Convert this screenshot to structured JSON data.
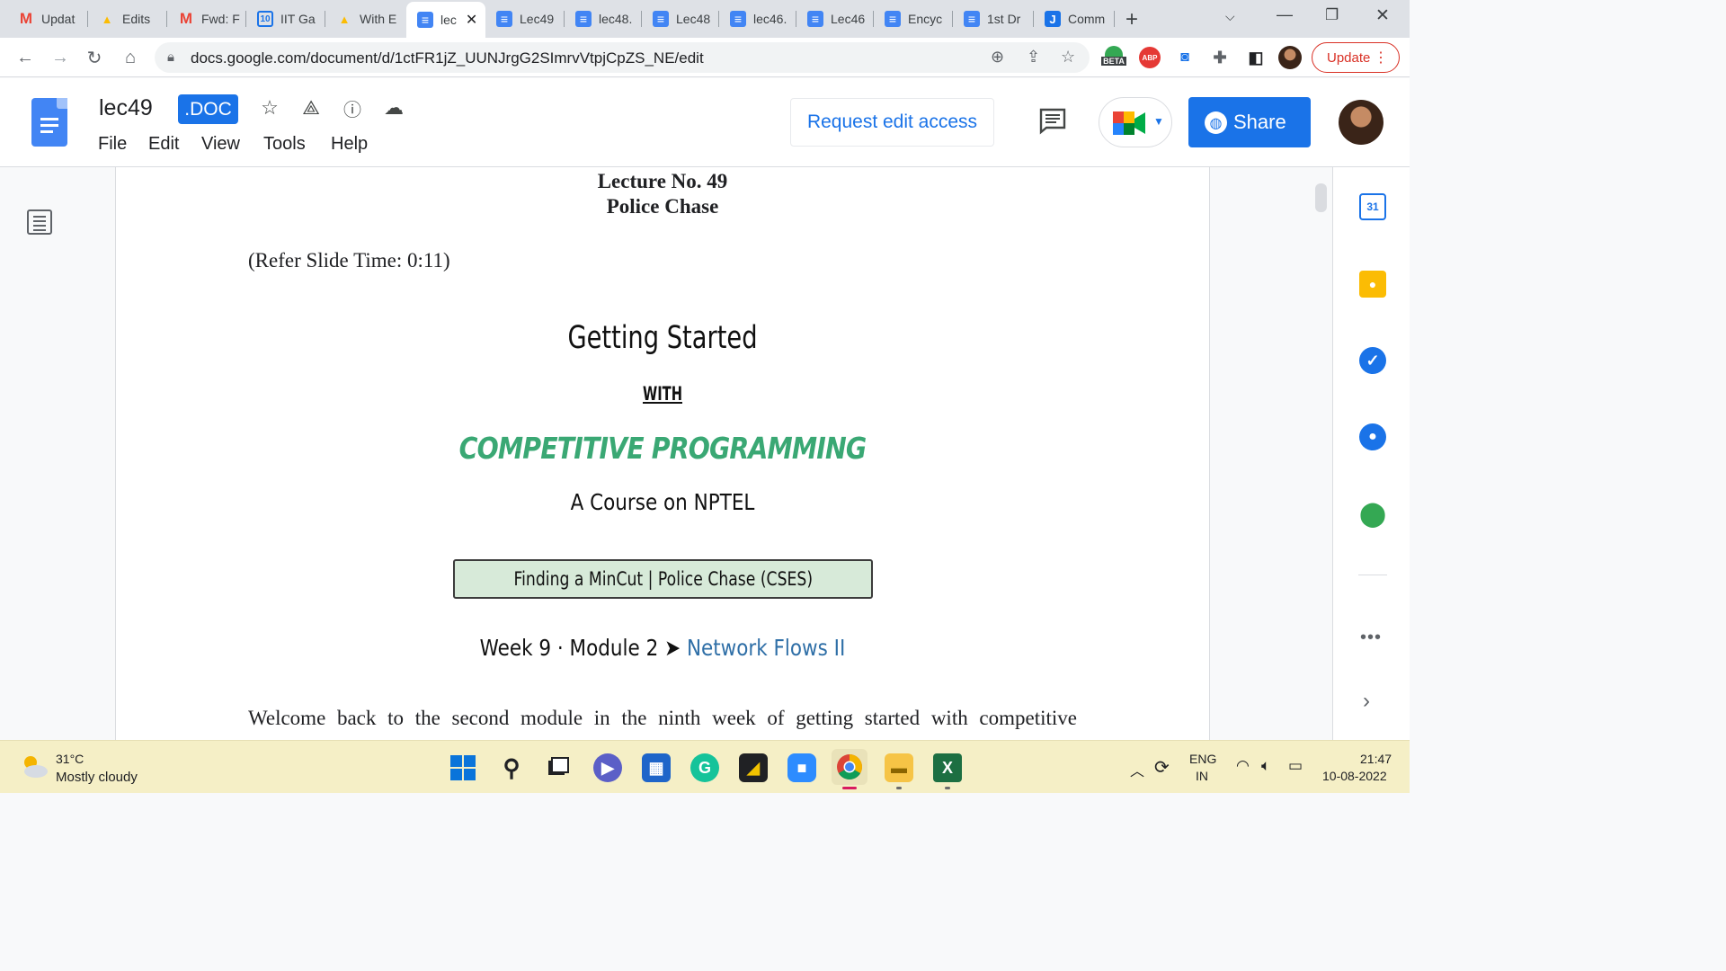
{
  "browser": {
    "tabs": [
      {
        "label": "Updat",
        "icon": "gmail-icon"
      },
      {
        "label": "Edits",
        "icon": "drive-icon"
      },
      {
        "label": "Fwd: F",
        "icon": "gmail-icon"
      },
      {
        "label": "IIT Ga",
        "icon": "ten-icon"
      },
      {
        "label": "With E",
        "icon": "drive-icon"
      },
      {
        "label": "lec",
        "icon": "docs-icon",
        "active": true
      },
      {
        "label": "Lec49",
        "icon": "docs-icon"
      },
      {
        "label": "lec48.",
        "icon": "docs-icon"
      },
      {
        "label": "Lec48",
        "icon": "docs-icon"
      },
      {
        "label": "lec46.",
        "icon": "docs-icon"
      },
      {
        "label": "Lec46",
        "icon": "docs-icon"
      },
      {
        "label": "Encyc",
        "icon": "docs-icon"
      },
      {
        "label": "1st Dr",
        "icon": "docs-icon"
      },
      {
        "label": "Comm",
        "icon": "j-icon"
      }
    ],
    "url": "docs.google.com/document/d/1ctFR1jZ_UUNJrgG2SImrvVtpjCpZS_NE/edit",
    "update_label": "Update",
    "beta_label": "BETA",
    "abp_label": "ABP"
  },
  "docs": {
    "title": "lec49",
    "badge": ".DOC",
    "menu": [
      "File",
      "Edit",
      "View",
      "Tools",
      "Help"
    ],
    "request_label": "Request edit access",
    "share_label": "Share"
  },
  "document": {
    "lecture_no": "Lecture No. 49",
    "lecture_title": "Police Chase",
    "refer": "(Refer Slide Time: 0:11)",
    "slide": {
      "heading": "Getting Started",
      "with": "WITH",
      "subtitle": "COMPETITIVE PROGRAMMING",
      "course": "A Course on NPTEL",
      "box_text": "Finding a MinCut | Police Chase (CSES)",
      "week_prefix": "Week 9 · Module 2 ➤ ",
      "week_link": "Network Flows II"
    },
    "body": "Welcome back to the second module in the ninth week of getting started with competitive"
  },
  "side_panel": {
    "calendar_day": "31"
  },
  "taskbar": {
    "temperature": "31°C",
    "weather": "Mostly cloudy",
    "lang_line1": "ENG",
    "lang_line2": "IN",
    "time": "21:47",
    "date": "10-08-2022"
  },
  "colors": {
    "accent": "#1a73e8",
    "slide_green": "#3aa874",
    "slide_box": "#d7ead9",
    "taskbar": "#f5efc6"
  }
}
